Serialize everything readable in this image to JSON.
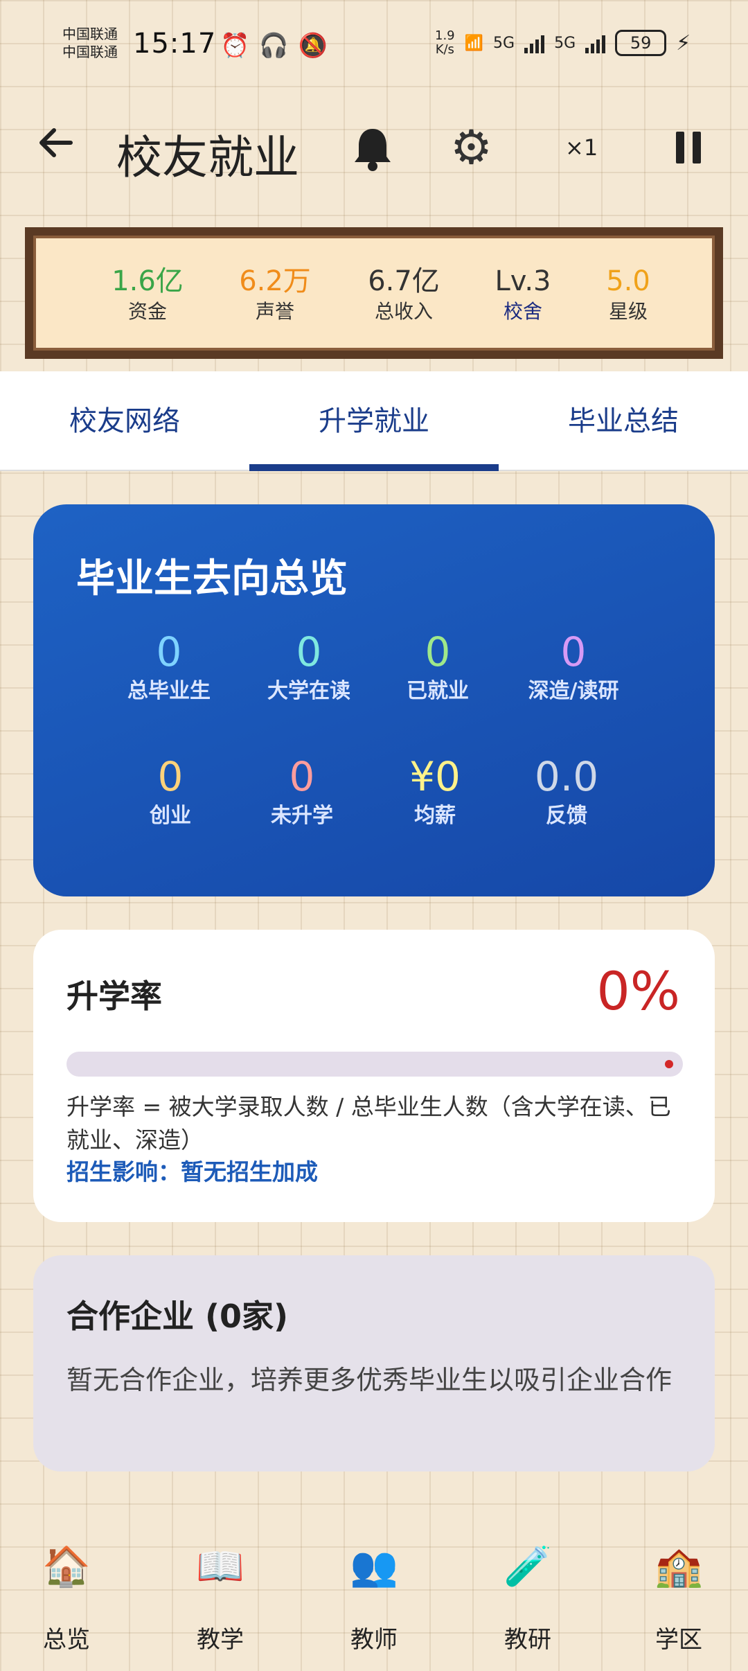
{
  "status_bar": {
    "carrier_1": "中国联通",
    "carrier_2": "中国联通",
    "time": "15:17",
    "net_speed": "1.9",
    "net_speed_unit": "K/s",
    "signal_1": "5G",
    "signal_2": "5G",
    "battery": "59"
  },
  "header": {
    "back_icon": "arrow-left-icon",
    "title": "校友就业",
    "speed": "×1"
  },
  "stats": [
    {
      "value": "1.6亿",
      "label": "资金",
      "color": "#3aa548"
    },
    {
      "value": "6.2万",
      "label": "声誉",
      "color": "#f08c1a"
    },
    {
      "value": "6.7亿",
      "label": "总收入",
      "color": "#333333"
    },
    {
      "value": "Lv.3",
      "label": "校舍",
      "color": "#333333"
    },
    {
      "value": "5.0",
      "label": "星级",
      "color": "#f0a21a"
    }
  ],
  "tabs": [
    {
      "label": "校友网络"
    },
    {
      "label": "升学就业",
      "active": true
    },
    {
      "label": "毕业总结"
    }
  ],
  "overview": {
    "title": "毕业生去向总览",
    "items": [
      {
        "value": "0",
        "label": "总毕业生",
        "color": "#7fd3ff"
      },
      {
        "value": "0",
        "label": "大学在读",
        "color": "#7fe8e0"
      },
      {
        "value": "0",
        "label": "已就业",
        "color": "#9fe88a"
      },
      {
        "value": "0",
        "label": "深造/读研",
        "color": "#d79af5"
      },
      {
        "value": "0",
        "label": "创业",
        "color": "#ffd27a"
      },
      {
        "value": "0",
        "label": "未升学",
        "color": "#ff9d9d"
      },
      {
        "value": "¥0",
        "label": "均薪",
        "color": "#fff28a"
      },
      {
        "value": "0.0",
        "label": "反馈",
        "color": "#cfd8e8"
      }
    ]
  },
  "rate": {
    "title": "升学率",
    "value": "0%",
    "progress_fraction": 0,
    "description": "升学率 = 被大学录取人数 / 总毕业生人数（含大学在读、已就业、深造）",
    "influence": "招生影响：暂无招生加成"
  },
  "partner": {
    "title": "合作企业 (0家)",
    "description": "暂无合作企业，培养更多优秀毕业生以吸引企业合作"
  },
  "bottom_nav": [
    {
      "label": "总览",
      "icon": "school-house-icon"
    },
    {
      "label": "教学",
      "icon": "open-book-icon"
    },
    {
      "label": "教师",
      "icon": "teachers-icon"
    },
    {
      "label": "教研",
      "icon": "flask-icon"
    },
    {
      "label": "学区",
      "icon": "campus-building-icon"
    }
  ]
}
